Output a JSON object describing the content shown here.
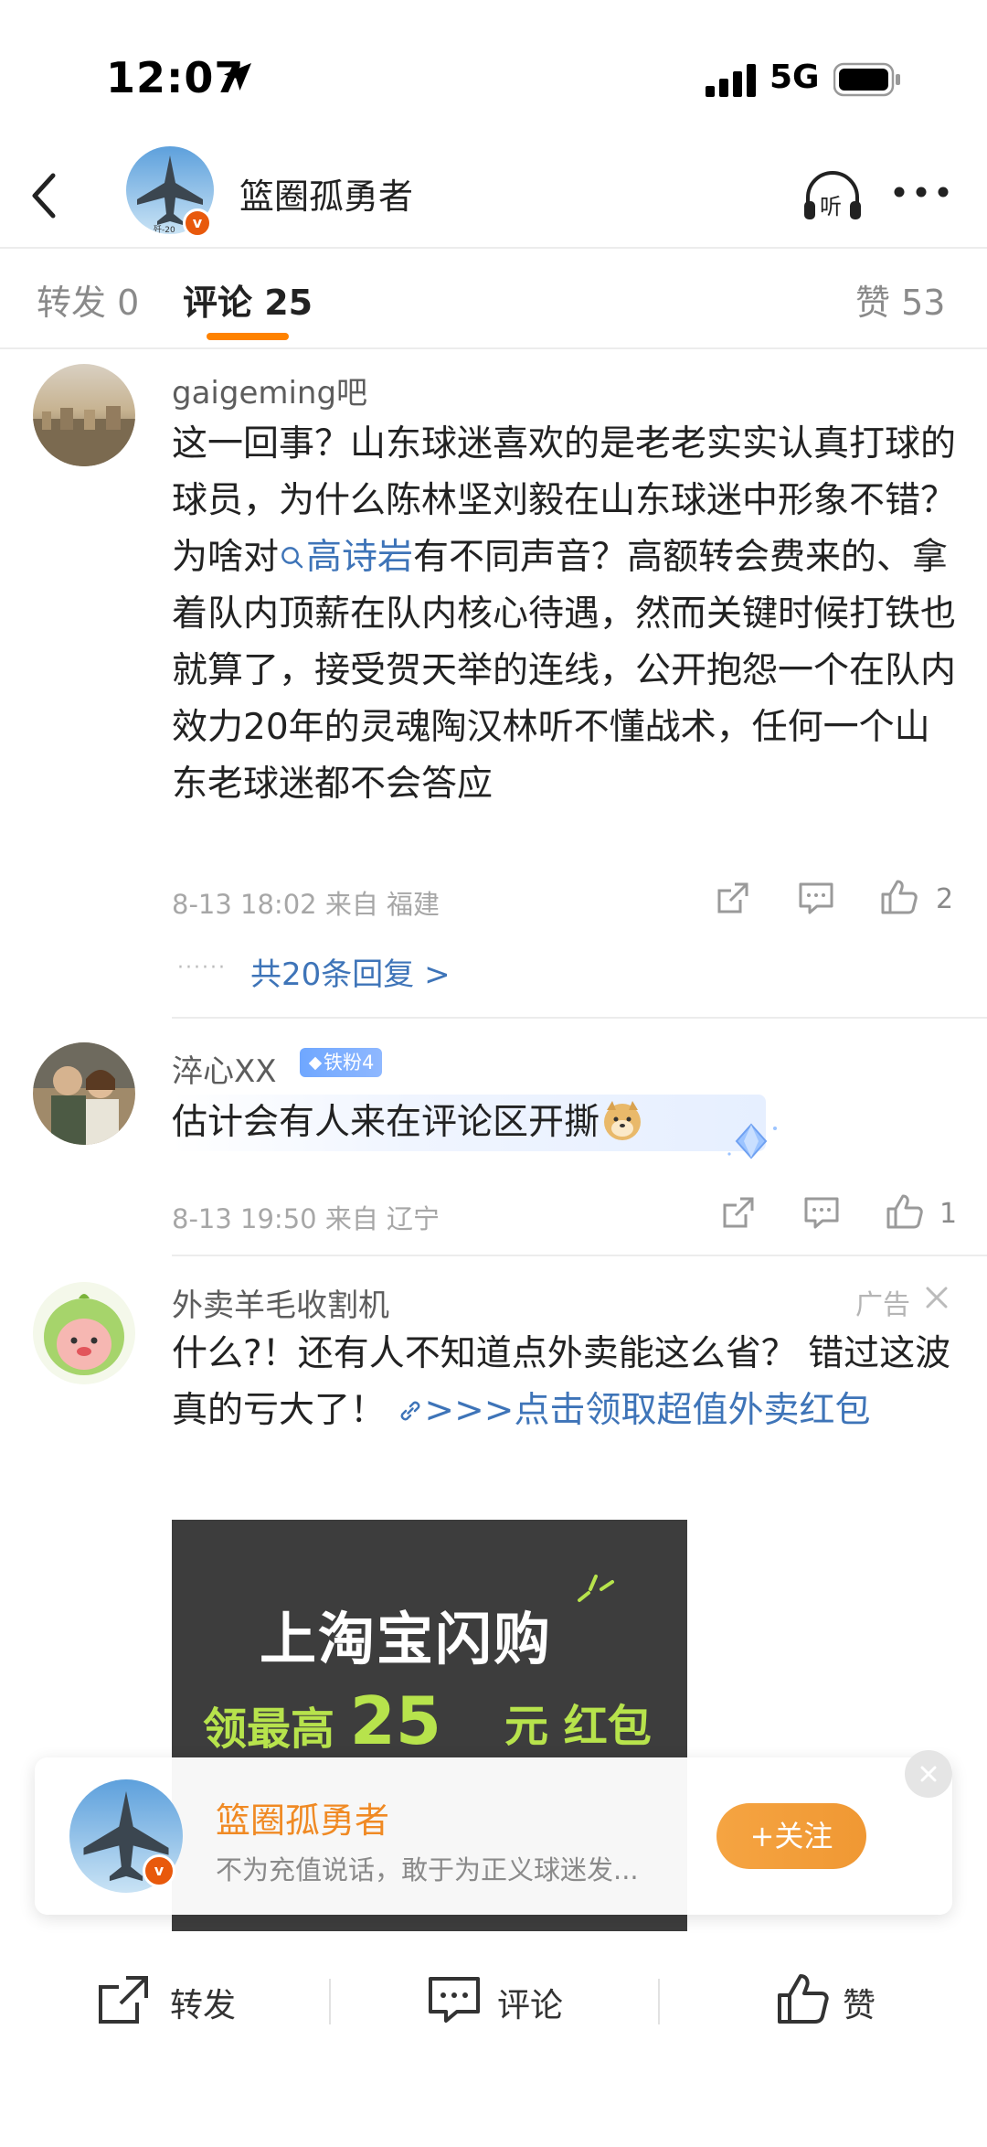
{
  "status_bar": {
    "time": "12:07",
    "network": "5G"
  },
  "header": {
    "title": "篮圈孤勇者",
    "avatar_caption": "歼-20",
    "listen_label": "听"
  },
  "tabs": [
    {
      "label": "转发 0"
    },
    {
      "label": "评论 25"
    },
    {
      "label": "赞 53"
    }
  ],
  "comments": [
    {
      "username": "gaigeming吧",
      "text_before": "这一回事？山东球迷喜欢的是老老实实认真打球的球员，为什么陈林坚刘毅在山东球迷中形象不错？为啥对",
      "link_text": "高诗岩",
      "text_after": "有不同声音？高额转会费来的、拿着队内顶薪在队内核心待遇，然而关键时候打铁也就算了，接受贺天举的连线，公开抱怨一个在队内效力20年的灵魂陶汉林听不懂战术，任何一个山东老球迷都不会答应",
      "meta": "8-13 18:02  来自 福建",
      "likes": "2",
      "replies_label": "共20条回复 >"
    },
    {
      "username": "淬心XX",
      "badge": "铁粉4",
      "text": "估计会有人来在评论区开撕",
      "meta": "8-13 19:50  来自 辽宁",
      "likes": "1"
    },
    {
      "username": "外卖羊毛收割机",
      "ad_tag": "广告",
      "text": "什么?！还有人不知道点外卖能这么省？ 错过这波真的亏大了！ ",
      "link_text": ">>>点击领取超值外卖红包",
      "image": {
        "line1": "上淘宝闪购",
        "line2_prefix": "领最高",
        "line2_amount": "25",
        "line2_suffix": "元 红包"
      }
    }
  ],
  "follow_card": {
    "name": "篮圈孤勇者",
    "description": "不为充值说话，敢于为正义球迷发...",
    "follow_label": "+关注"
  },
  "toolbar": {
    "repost": "转发",
    "comment": "评论",
    "like": "赞"
  },
  "colors": {
    "accent": "#ff8200",
    "link": "#3e74b8",
    "follow": "#f09833",
    "vip_badge": "#e8590c"
  }
}
